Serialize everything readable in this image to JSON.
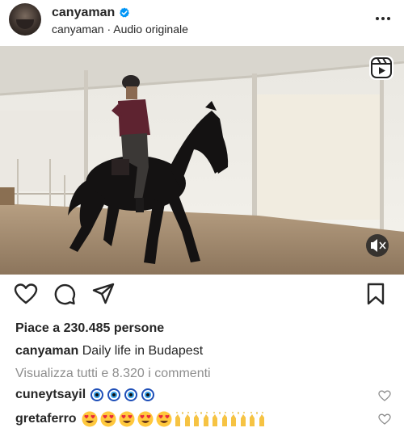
{
  "post": {
    "username": "canyaman",
    "subtitle": "canyaman · Audio originale",
    "likes": "Piace a 230.485 persone",
    "caption_user": "canyaman",
    "caption_text": "Daily life in Budapest",
    "view_comments": "Visualizza tutti e 8.320 i commenti"
  },
  "comments": [
    {
      "user": "cuneytsayil",
      "emoji_icons": [
        "nazar-amulet",
        "nazar-amulet",
        "nazar-amulet",
        "nazar-amulet"
      ]
    },
    {
      "user": "gretaferro",
      "emoji_icons": [
        "heart-eyes",
        "heart-eyes",
        "heart-eyes",
        "heart-eyes",
        "heart-eyes",
        "raising-hands",
        "raising-hands",
        "raising-hands",
        "raising-hands",
        "raising-hands"
      ]
    }
  ],
  "icons": [
    "avatar",
    "verified-badge-icon",
    "more-icon",
    "reels-icon",
    "mute-icon",
    "heart-icon",
    "comment-icon",
    "share-icon",
    "bookmark-icon"
  ],
  "colors": {
    "verified": "#0095f6",
    "text": "#262626",
    "muted": "#8e8e8e"
  }
}
